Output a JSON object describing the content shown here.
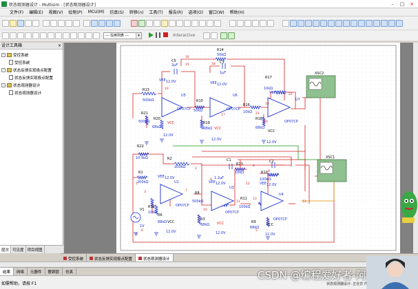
{
  "window": {
    "title": "状态观测器设计 - Multisim - [状态观测器设计]"
  },
  "menu": [
    "文件(F)",
    "编辑(E)",
    "视图(V)",
    "绘制(P)",
    "MCU(M)",
    "仿真(S)",
    "转移(n)",
    "工具(T)",
    "报告(R)",
    "选项(O)",
    "窗口(W)",
    "帮助(H)"
  ],
  "toolbar": {
    "in_use_list": "--- 在用列表 ---",
    "interactive": "Interactive"
  },
  "panel": {
    "title": "设计工具箱",
    "close": "×",
    "tree": [
      {
        "level": 1,
        "expander": "-",
        "label": "受控系统"
      },
      {
        "level": 2,
        "label": "受控系统"
      },
      {
        "level": 1,
        "expander": "-",
        "label": "状态反馈实现极点配置"
      },
      {
        "level": 2,
        "label": "状态反馈实现极点配置"
      },
      {
        "level": 1,
        "expander": "-",
        "label": "状态观测器设计"
      },
      {
        "level": 2,
        "label": "状态观测器设计"
      }
    ],
    "tabs": [
      "层次",
      "可见度",
      "项目视图"
    ]
  },
  "doc_tabs": [
    "受控系统",
    "状态反馈实现极点配置",
    "状态观测器设计"
  ],
  "bottom_tabs": [
    "结果",
    "网络",
    "元器件",
    "敷铜层",
    "仿真"
  ],
  "status": {
    "left": "如需帮助，请按 F1",
    "mid": "状态观测器设计: 正在仿 传真"
  },
  "watermark": "CSDN @编程爱好者-阿新",
  "colors": {
    "wire": "#d42020",
    "component": "#1a2fd0",
    "scope_bg": "#8fc08f",
    "canvas_bg": "#ffffff",
    "canvas_frame": "#808080"
  },
  "schematic": {
    "opamp_model": "OP07CP",
    "vee": "VEE",
    "vcc": "VCC",
    "supply": "12.0V",
    "scopes": [
      "XSC2",
      "XSC1"
    ],
    "top_labels": {
      "c5": "C5",
      "c5v": "2μF",
      "r14": "R14",
      "r14v": "50kΩ",
      "c3": "C3",
      "c3v": "1μF",
      "r13": "R13",
      "r13v": "500kΩ",
      "r21": "R21",
      "r21v": "500kΩ",
      "r20": "R20",
      "r20v": "68kΩ",
      "u5": "U5",
      "r15": "R15",
      "r15v": "50kΩ",
      "u6": "U6",
      "r19": "R19",
      "r19v": "68kΩ",
      "r17": "R17",
      "r17v": "10kΩ",
      "r16": "R16",
      "r16v": "10kΩ",
      "r18": "R18",
      "r18v": "68kΩ",
      "u7": "U7"
    },
    "bottom_labels": {
      "r22": "R22",
      "r22v": "10.5kΩ",
      "r2": "R2",
      "r2v": "200kΩ",
      "r1": "R1",
      "r1v": "200kΩ",
      "u1": "U1",
      "v1": "V1",
      "v1v": "1V",
      "r12": "R12",
      "r12v": "10kΩ",
      "r6": "R6",
      "r6v": "68kΩ",
      "r8": "R8",
      "r8v": "500kΩ",
      "c1": "C1",
      "c1v": "1.2μF",
      "r23": "R23",
      "r23v": "10kΩ",
      "u3": "U3",
      "r11": "R11",
      "r11v": "100kΩ",
      "r3": "R3",
      "r3v": "68kΩ",
      "c2": "C2",
      "c2v": "200nF",
      "r10": "R10",
      "r10v": "100kΩ",
      "r9": "R9",
      "r9v": "68kΩ",
      "u4": "U4"
    },
    "nets": [
      "15",
      "16",
      "18",
      "19",
      "17",
      "22",
      "21",
      "14",
      "3",
      "7",
      "11",
      "10",
      "13",
      "9",
      "12",
      "5",
      "6",
      "8",
      "0",
      "1",
      "2",
      "4",
      "20",
      "13"
    ]
  }
}
